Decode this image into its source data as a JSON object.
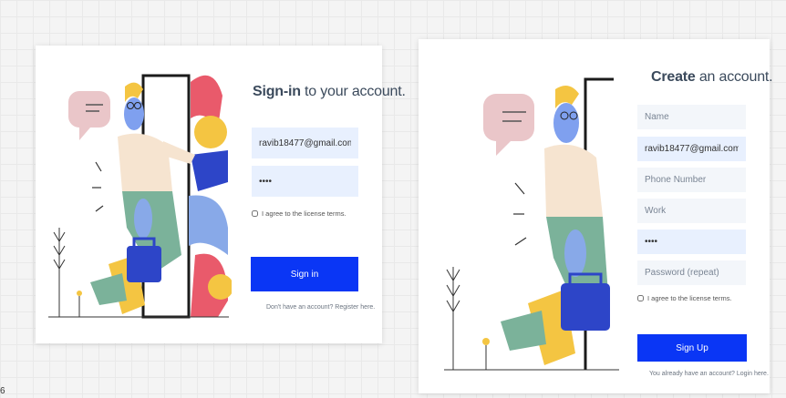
{
  "login": {
    "title_bold": "Sign-in",
    "title_rest": " to your account.",
    "email_value": "ravib18477@gmail.com",
    "password_value": "••••",
    "terms_label": "I agree to the license terms.",
    "submit_label": "Sign in",
    "footer_text": "Don't have an account? Register here."
  },
  "signup": {
    "title_bold": "Create",
    "title_rest": " an account.",
    "name_placeholder": "Name",
    "email_value": "ravib18477@gmail.com",
    "phone_placeholder": "Phone Number",
    "work_placeholder": "Work",
    "password_value": "••••",
    "password_repeat_placeholder": "Password (repeat)",
    "terms_label": "I agree to the license terms.",
    "submit_label": "Sign Up",
    "footer_text": "You already have an account? Login here."
  },
  "page_number": "6",
  "colors": {
    "accent": "#0a36f5",
    "field_bg": "#f3f6fa",
    "field_filled_bg": "#e8f0fe"
  }
}
